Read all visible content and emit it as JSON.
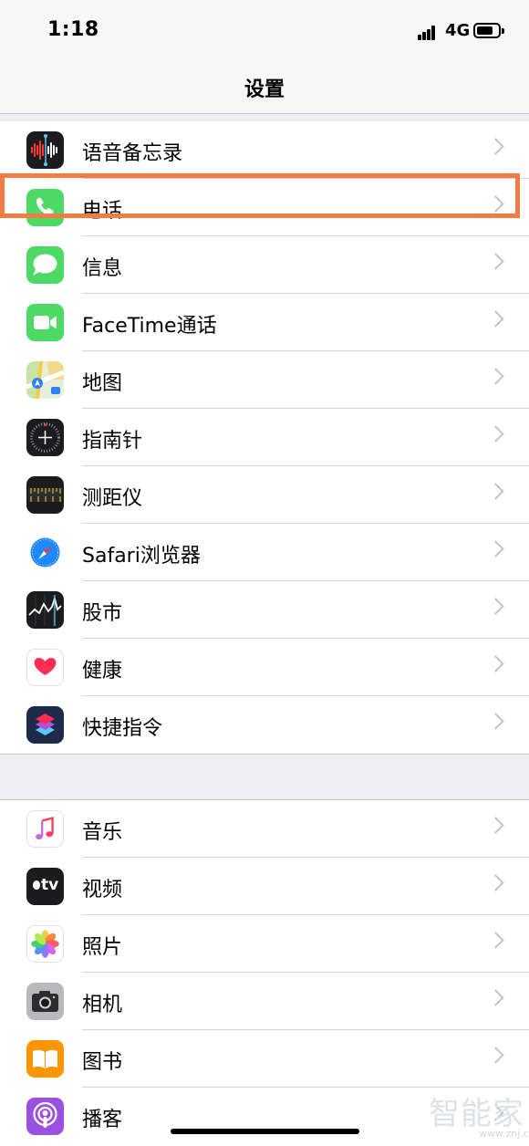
{
  "status_bar": {
    "time": "1:18",
    "network": "4G",
    "battery_percent": 70
  },
  "nav": {
    "title": "设置"
  },
  "group1": [
    {
      "label": "语音备忘录",
      "icon": "voice-memos-icon"
    },
    {
      "label": "电话",
      "icon": "phone-icon"
    },
    {
      "label": "信息",
      "icon": "messages-icon"
    },
    {
      "label": "FaceTime通话",
      "icon": "facetime-icon"
    },
    {
      "label": "地图",
      "icon": "maps-icon"
    },
    {
      "label": "指南针",
      "icon": "compass-icon"
    },
    {
      "label": "测距仪",
      "icon": "measure-icon"
    },
    {
      "label": "Safari浏览器",
      "icon": "safari-icon"
    },
    {
      "label": "股市",
      "icon": "stocks-icon"
    },
    {
      "label": "健康",
      "icon": "health-icon"
    },
    {
      "label": "快捷指令",
      "icon": "shortcuts-icon"
    }
  ],
  "group2": [
    {
      "label": "音乐",
      "icon": "music-icon"
    },
    {
      "label": "视频",
      "icon": "tv-icon"
    },
    {
      "label": "照片",
      "icon": "photos-icon"
    },
    {
      "label": "相机",
      "icon": "camera-icon"
    },
    {
      "label": "图书",
      "icon": "books-icon"
    },
    {
      "label": "播客",
      "icon": "podcasts-icon"
    }
  ],
  "highlighted_item": "电话",
  "tv_icon_text": "tv",
  "watermark": {
    "text": "智能家",
    "url": "www.znj.com"
  },
  "colors": {
    "highlight_border": "#f47a46",
    "background": "#efeff4",
    "chevron": "#c4c4c7"
  }
}
